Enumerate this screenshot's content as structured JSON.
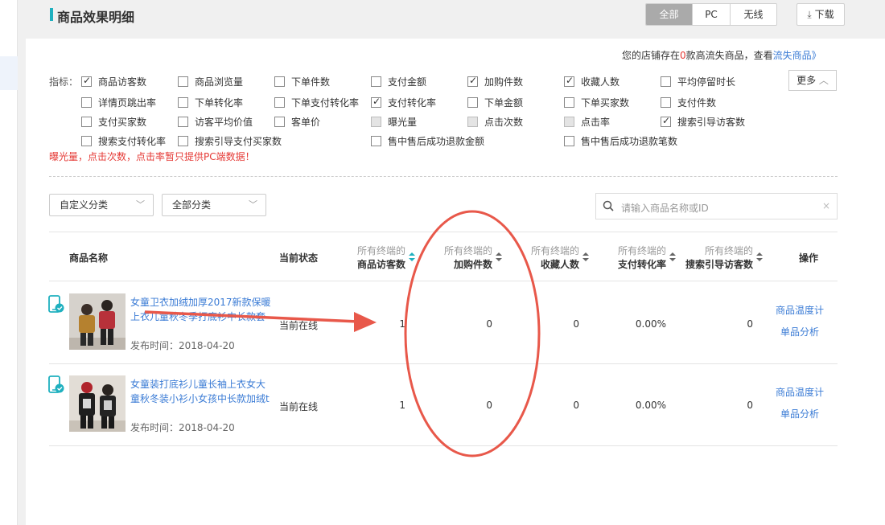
{
  "page": {
    "title": "商品效果明细",
    "segments": [
      {
        "label": "全部",
        "active": true
      },
      {
        "label": "PC",
        "active": false
      },
      {
        "label": "无线",
        "active": false
      }
    ],
    "download_label": "下载"
  },
  "notice": {
    "prefix": "您的店铺存在",
    "count": "0",
    "middle": "款高流失商品，查看",
    "link": "流失商品》"
  },
  "metrics": {
    "label": "指标：",
    "more_label": "更多",
    "items": [
      {
        "label": "商品访客数",
        "checked": true,
        "disabled": false
      },
      {
        "label": "商品浏览量",
        "checked": false,
        "disabled": false
      },
      {
        "label": "下单件数",
        "checked": false,
        "disabled": false
      },
      {
        "label": "支付金额",
        "checked": false,
        "disabled": false
      },
      {
        "label": "加购件数",
        "checked": true,
        "disabled": false
      },
      {
        "label": "收藏人数",
        "checked": true,
        "disabled": false
      },
      {
        "label": "平均停留时长",
        "checked": false,
        "disabled": false
      },
      {
        "label": "详情页跳出率",
        "checked": false,
        "disabled": false
      },
      {
        "label": "下单转化率",
        "checked": false,
        "disabled": false
      },
      {
        "label": "下单支付转化率",
        "checked": false,
        "disabled": false
      },
      {
        "label": "支付转化率",
        "checked": true,
        "disabled": false
      },
      {
        "label": "下单金额",
        "checked": false,
        "disabled": false
      },
      {
        "label": "下单买家数",
        "checked": false,
        "disabled": false
      },
      {
        "label": "支付件数",
        "checked": false,
        "disabled": false
      },
      {
        "label": "支付买家数",
        "checked": false,
        "disabled": false
      },
      {
        "label": "访客平均价值",
        "checked": false,
        "disabled": false
      },
      {
        "label": "客单价",
        "checked": false,
        "disabled": false
      },
      {
        "label": "曝光量",
        "checked": false,
        "disabled": true
      },
      {
        "label": "点击次数",
        "checked": false,
        "disabled": true
      },
      {
        "label": "点击率",
        "checked": false,
        "disabled": true
      },
      {
        "label": "搜索引导访客数",
        "checked": true,
        "disabled": false
      },
      {
        "label": "搜索支付转化率",
        "checked": false,
        "disabled": false
      },
      {
        "label": "搜索引导支付买家数",
        "checked": false,
        "disabled": false
      },
      {
        "label": "售中售后成功退款金额",
        "checked": false,
        "disabled": false
      },
      {
        "label": "售中售后成功退款笔数",
        "checked": false,
        "disabled": false
      }
    ],
    "warning": "曝光量，点击次数，点击率暂只提供PC端数据！"
  },
  "filters": {
    "category1": "自定义分类",
    "category2": "全部分类",
    "search_placeholder": "请输入商品名称或ID",
    "clear": "×"
  },
  "table": {
    "headers": {
      "name": "商品名称",
      "status": "当前状态",
      "sub": "所有终端的",
      "visitors": "商品访客数",
      "cart": "加购件数",
      "fav": "收藏人数",
      "conv": "支付转化率",
      "search": "搜索引导访客数",
      "ops": "操作"
    },
    "rows": [
      {
        "title_line1": "女童卫衣加绒加厚2017新款保暖",
        "title_line2": "上衣儿童秋冬季打底衫中长款套",
        "date": "发布时间：2018-04-20",
        "status": "当前在线",
        "visitors": "1",
        "cart": "0",
        "fav": "0",
        "conv": "0.00%",
        "search": "0",
        "op1": "商品温度计",
        "op2": "单品分析"
      },
      {
        "title_line1": "女童装打底衫儿童长袖上衣女大",
        "title_line2": "童秋冬装小衫小女孩中长款加绒t",
        "date": "发布时间：2018-04-20",
        "status": "当前在线",
        "visitors": "1",
        "cart": "0",
        "fav": "0",
        "conv": "0.00%",
        "search": "0",
        "op1": "商品温度计",
        "op2": "单品分析"
      }
    ]
  },
  "colors": {
    "accent": "#1fb0bf",
    "link": "#3a7bd5",
    "warning": "#e53935",
    "annotation": "#e8584a"
  }
}
